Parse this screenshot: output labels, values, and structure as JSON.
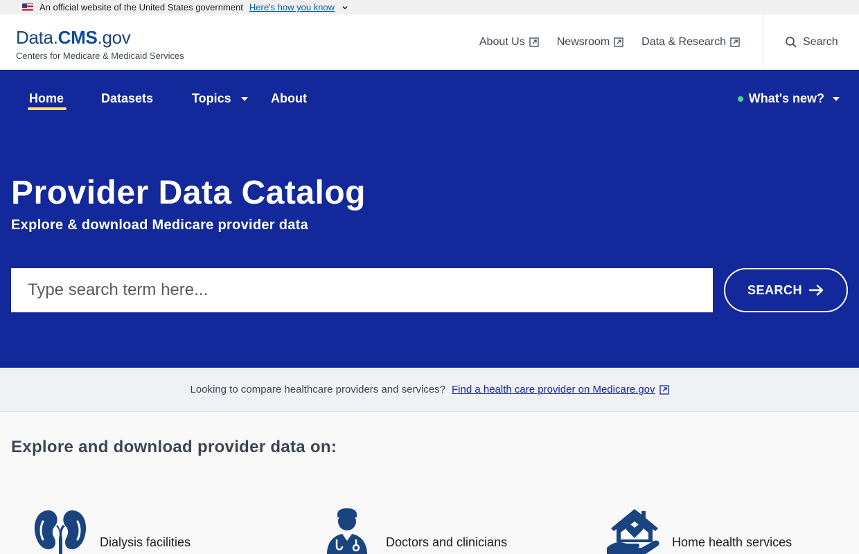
{
  "gov_banner": {
    "text": "An official website of the United States government",
    "link": "Here's how you know"
  },
  "header": {
    "logo_data": "Data.",
    "logo_cms": "CMS",
    "logo_gov": ".gov",
    "logo_subtitle": "Centers for Medicare & Medicaid Services",
    "util_nav": [
      "About Us",
      "Newsroom",
      "Data & Research"
    ],
    "search_label": "Search"
  },
  "main_nav": {
    "home": "Home",
    "datasets": "Datasets",
    "topics": "Topics",
    "about": "About",
    "whats_new": "What's new?"
  },
  "hero": {
    "title": "Provider Data Catalog",
    "subtitle": "Explore & download Medicare provider data",
    "search_placeholder": "Type search term here...",
    "search_button": "SEARCH"
  },
  "compare_bar": {
    "text": "Looking to compare healthcare providers and services?",
    "link": "Find a health care provider on Medicare.gov"
  },
  "explore": {
    "title": "Explore and download provider data on:",
    "categories": [
      {
        "label": "Dialysis facilities",
        "icon": "kidneys-icon"
      },
      {
        "label": "Doctors and clinicians",
        "icon": "doctor-icon"
      },
      {
        "label": "Home health services",
        "icon": "home-health-icon"
      }
    ]
  },
  "colors": {
    "nav_bg": "#13289a",
    "accent_underline": "#fad980",
    "new_dot": "#3bdb90",
    "icon_blue": "#1a4480"
  }
}
